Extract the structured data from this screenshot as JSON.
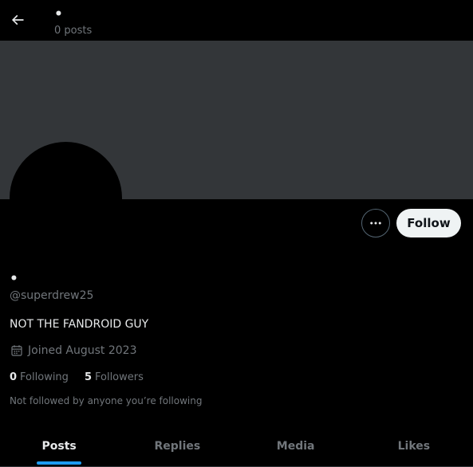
{
  "header": {
    "display_name": "•",
    "post_count": "0 posts",
    "back_icon": "arrow-left-icon"
  },
  "profile": {
    "display_name": "•",
    "handle": "@superdrew25",
    "bio": "NOT THE FANDROID GUY",
    "joined": "Joined August 2023",
    "following_count": "0",
    "following_label": "Following",
    "followers_count": "5",
    "followers_label": "Followers",
    "not_followed_text": "Not followed by anyone you’re following"
  },
  "actions": {
    "follow_label": "Follow",
    "more_icon": "more-horizontal-icon"
  },
  "tabs": [
    {
      "label": "Posts",
      "active": true
    },
    {
      "label": "Replies",
      "active": false
    },
    {
      "label": "Media",
      "active": false
    },
    {
      "label": "Likes",
      "active": false
    }
  ],
  "colors": {
    "background": "#000000",
    "banner": "#333639",
    "accent": "#1d9bf0",
    "primary_text": "#e7e9ea",
    "secondary_text": "#71767b"
  }
}
